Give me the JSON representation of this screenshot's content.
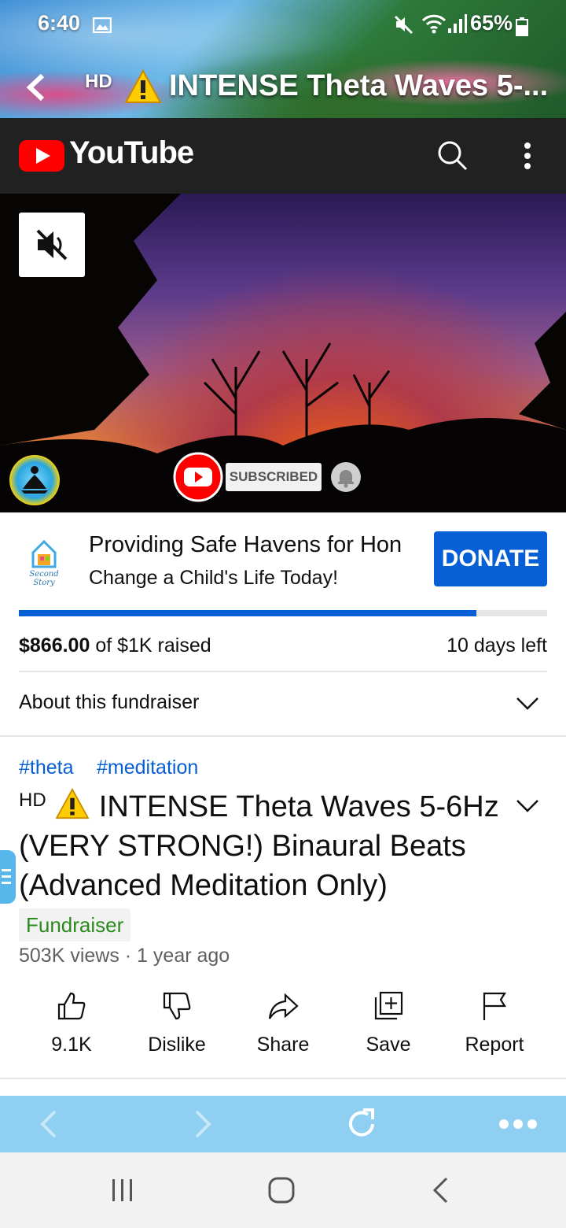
{
  "status_bar": {
    "time": "6:40",
    "battery": "65%"
  },
  "app_header": {
    "hd_badge": "HD",
    "title": "INTENSE Theta Waves 5-..."
  },
  "youtube_header": {
    "wordmark": "YouTube"
  },
  "video": {
    "subscribed_label": "SUBSCRIBED"
  },
  "fundraiser": {
    "title": "Providing Safe Havens for Hon",
    "subtitle": "Change a Child's Life Today!",
    "donate_label": "DONATE",
    "progress_fraction": 0.866,
    "raised_amount": "$866.00",
    "raised_rest": " of $1K raised",
    "days_left": "10 days left",
    "about_label": "About this fundraiser",
    "org_logo_text": "Second Story"
  },
  "video_info": {
    "hashtags": [
      "#theta",
      "#meditation"
    ],
    "hd_badge": "HD",
    "title": "INTENSE Theta Waves 5-6Hz (VERY STRONG!) Binaural Beats (Advanced Meditation Only)",
    "chip": "Fundraiser",
    "views_meta": "503K views · 1 year ago"
  },
  "actions": [
    {
      "label": "9.1K"
    },
    {
      "label": "Dislike"
    },
    {
      "label": "Share"
    },
    {
      "label": "Save"
    },
    {
      "label": "Report"
    }
  ],
  "colors": {
    "youtube_red": "#ff0000",
    "accent_blue": "#065fd4",
    "fundraiser_green": "#2b8a1e",
    "browser_bar": "#8fd0f2"
  }
}
